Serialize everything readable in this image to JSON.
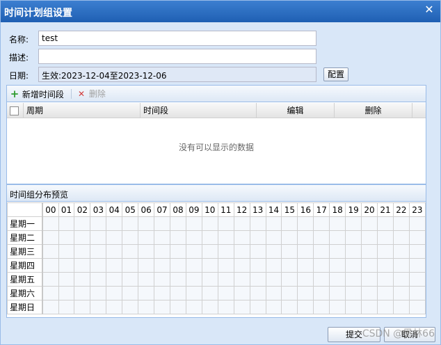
{
  "window": {
    "title": "时间计划组设置",
    "close_glyph": "✕"
  },
  "form": {
    "name_label": "名称:",
    "name_value": "test",
    "desc_label": "描述:",
    "desc_value": "",
    "date_label": "日期:",
    "date_value": "生效:2023-12-04至2023-12-06",
    "config_button": "配置"
  },
  "toolbar": {
    "add_label": "新增时间段",
    "add_icon": "plus-icon",
    "delete_label": "删除",
    "delete_icon": "x-icon"
  },
  "grid": {
    "columns": [
      "周期",
      "时间段",
      "编辑",
      "删除"
    ],
    "empty_text": "没有可以显示的数据"
  },
  "preview": {
    "title": "时间组分布预览",
    "hours": [
      "00",
      "01",
      "02",
      "03",
      "04",
      "05",
      "06",
      "07",
      "08",
      "09",
      "10",
      "11",
      "12",
      "13",
      "14",
      "15",
      "16",
      "17",
      "18",
      "19",
      "20",
      "21",
      "22",
      "23"
    ],
    "days": [
      "星期一",
      "星期二",
      "星期三",
      "星期四",
      "星期五",
      "星期六",
      "星期日"
    ]
  },
  "footer": {
    "submit_label": "提交",
    "cancel_label": "取消"
  },
  "watermark": "CSDN @墨林66",
  "colors": {
    "title_bar": "#1f5fb3",
    "panel_border": "#99bbe8",
    "dialog_bg": "#d9e7f8"
  }
}
